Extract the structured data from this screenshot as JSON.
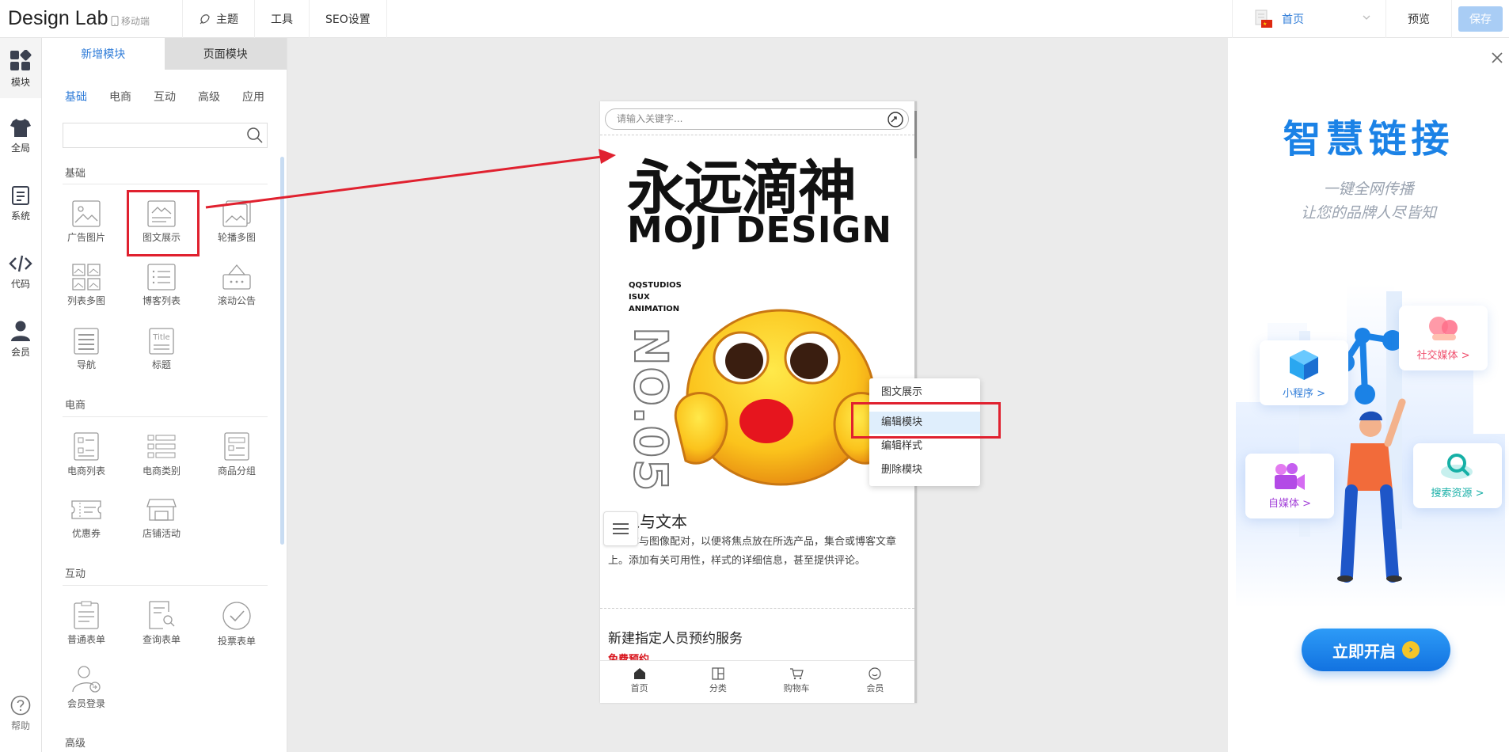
{
  "app": {
    "brand": "Design Lab",
    "mobile_label": "移动端"
  },
  "top_nav": [
    {
      "label": "主题"
    },
    {
      "label": "工具"
    },
    {
      "label": "SEO设置"
    }
  ],
  "top_right": {
    "page_select": "首页",
    "preview": "预览",
    "save": "保存"
  },
  "rail": [
    {
      "label": "模块"
    },
    {
      "label": "全局"
    },
    {
      "label": "系统"
    },
    {
      "label": "代码"
    },
    {
      "label": "会员"
    },
    {
      "label": "帮助"
    }
  ],
  "panel": {
    "tabs": [
      "新增模块",
      "页面模块"
    ],
    "sub_tabs": [
      "基础",
      "电商",
      "互动",
      "高级",
      "应用"
    ],
    "search_value": "",
    "sections": {
      "basic": {
        "title": "基础",
        "items": [
          "广告图片",
          "图文展示",
          "轮播多图",
          "列表多图",
          "博客列表",
          "滚动公告",
          "导航",
          "标题"
        ]
      },
      "ecommerce": {
        "title": "电商",
        "items": [
          "电商列表",
          "电商类别",
          "商品分组",
          "优惠券",
          "店铺活动"
        ]
      },
      "interactive": {
        "title": "互动",
        "items": [
          "普通表单",
          "查询表单",
          "投票表单",
          "会员登录"
        ]
      },
      "advanced": {
        "title": "高级"
      }
    }
  },
  "phone": {
    "search_placeholder": "请输入关键字...",
    "poster": {
      "title": "永远滴神",
      "subtitle": "MOJI DESIGN",
      "tags": [
        "QQSTUDIOS",
        "ISUX",
        "ANIMATION"
      ],
      "number": "NO.05"
    },
    "article": {
      "title": "图像与文本",
      "body": "将文本与图像配对，以便将焦点放在所选产品，集合或博客文章上。添加有关可用性，样式的详细信息，甚至提供评论。"
    },
    "service": {
      "title": "新建指定人员预约服务",
      "tag": "免费预约"
    },
    "tabbar": [
      "首页",
      "分类",
      "购物车",
      "会员"
    ]
  },
  "context_menu": {
    "header": "图文展示",
    "items": [
      "编辑模块",
      "编辑样式",
      "删除模块"
    ]
  },
  "promo": {
    "title": "智慧链接",
    "line1": "一键全网传播",
    "line2": "让您的品牌人尽皆知",
    "cards": [
      "小程序 >",
      "社交媒体 >",
      "自媒体 >",
      "搜索资源 >"
    ],
    "cta": "立即开启"
  },
  "colors": {
    "accent": "#2f7cd8",
    "highlight": "#e0212f",
    "promo_blue": "#1b82e6"
  }
}
